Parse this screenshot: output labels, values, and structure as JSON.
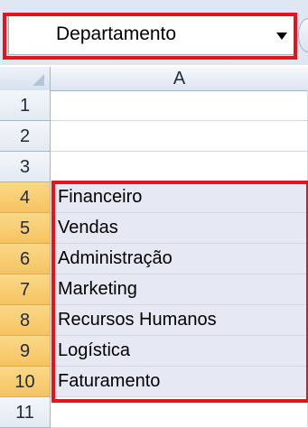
{
  "name_box": {
    "value": "Departamento"
  },
  "column_header": {
    "label": "A"
  },
  "rows": [
    {
      "num": "1",
      "value": ""
    },
    {
      "num": "2",
      "value": ""
    },
    {
      "num": "3",
      "value": ""
    },
    {
      "num": "4",
      "value": "Financeiro"
    },
    {
      "num": "5",
      "value": "Vendas"
    },
    {
      "num": "6",
      "value": "Administração"
    },
    {
      "num": "7",
      "value": "Marketing"
    },
    {
      "num": "8",
      "value": "Recursos Humanos"
    },
    {
      "num": "9",
      "value": "Logística"
    },
    {
      "num": "10",
      "value": "Faturamento"
    },
    {
      "num": "11",
      "value": ""
    }
  ],
  "colors": {
    "highlight": "#e3141b",
    "selected_row_header": "#f6c360",
    "selected_cell": "#e6e9f4"
  }
}
